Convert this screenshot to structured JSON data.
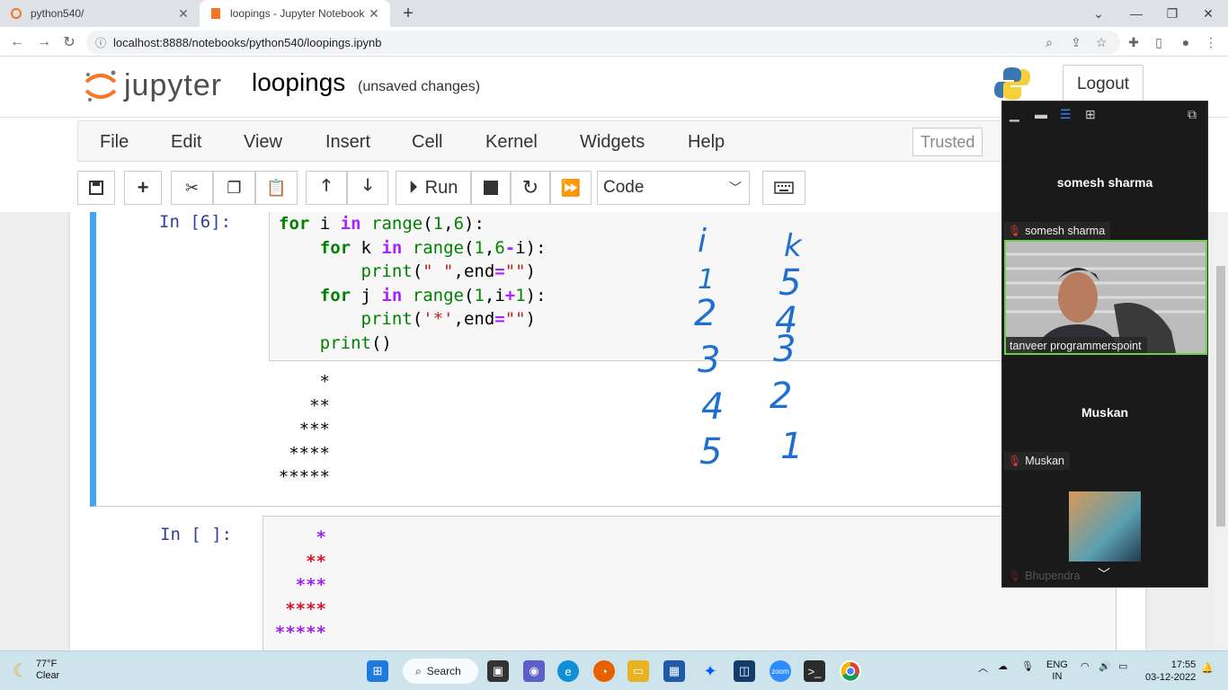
{
  "browser": {
    "tabs": [
      {
        "title": "python540/",
        "active": false
      },
      {
        "title": "loopings - Jupyter Notebook",
        "active": true
      }
    ],
    "url": "localhost:8888/notebooks/python540/loopings.ipynb"
  },
  "jupyter": {
    "logo_text": "jupyter",
    "notebook_name": "loopings",
    "save_status": "(unsaved changes)",
    "logout_label": "Logout",
    "menu": [
      "File",
      "Edit",
      "View",
      "Insert",
      "Cell",
      "Kernel",
      "Widgets",
      "Help"
    ],
    "trusted_label": "Trusted",
    "run_label": "Run",
    "cell_type": "Code"
  },
  "cells": [
    {
      "prompt": "In [6]:",
      "code_lines": [
        "for i in range(1,6):",
        "    for k in range(1,6-i):",
        "        print(\" \",end=\"\")",
        "    for j in range(1,i+1):",
        "        print('*',end=\"\")",
        "    print()"
      ],
      "output": [
        "*",
        "**",
        "***",
        "****",
        "*****"
      ]
    },
    {
      "prompt": "In [ ]:",
      "stars": [
        "*",
        "**",
        "***",
        "****",
        "*****"
      ]
    }
  ],
  "handwriting": {
    "col_i": [
      "i",
      "1",
      "2",
      "3",
      "4",
      "5"
    ],
    "col_k": [
      "k",
      "5",
      "4",
      "3",
      "2",
      "1"
    ]
  },
  "zoom": {
    "participant1_name": "somesh sharma",
    "participant1_tag": "somesh sharma",
    "video_tag": "tanveer programmerspoint",
    "participant2_name": "Muskan",
    "participant2_tag": "Muskan",
    "participant3_tag": "Bhupendra"
  },
  "taskbar": {
    "temperature": "77°F",
    "condition": "Clear",
    "search_label": "Search",
    "lang1": "ENG",
    "lang2": "IN",
    "time": "17:55",
    "date": "03-12-2022"
  }
}
